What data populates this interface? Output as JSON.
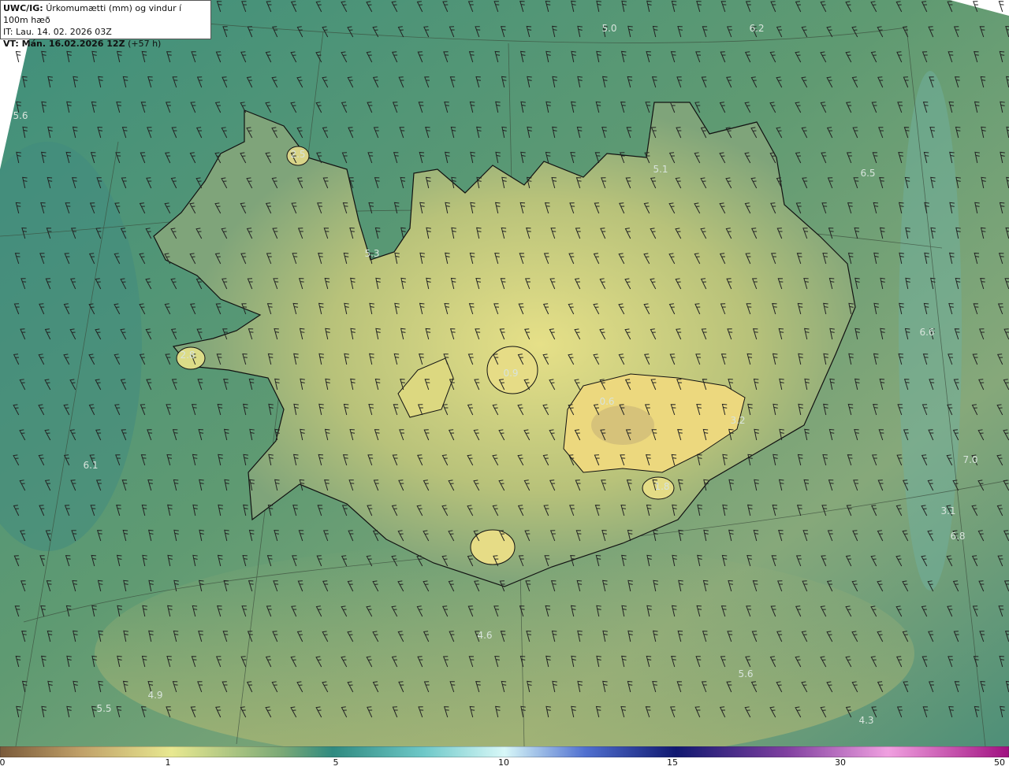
{
  "title": {
    "prefix": "UWC/IG:",
    "text": "Úrkomumætti (mm) og vindur í 100m hæð",
    "it": "IT: Lau. 14. 02. 2026 03Z",
    "vt_prefix": "VT: Mán. 16.02.2026 12Z",
    "vt_suffix": "(+57 h)"
  },
  "colorbar": {
    "ticks": [
      "0",
      "1",
      "5",
      "10",
      "15",
      "30",
      "50"
    ],
    "colors": [
      "#7a5a3a",
      "#c8a868",
      "#e8e890",
      "#4a8a70",
      "#3a9a98",
      "#b8f0f8",
      "#3050c0",
      "#102080",
      "#703090",
      "#e070c0",
      "#a01080"
    ]
  },
  "values": [
    {
      "label": "5.0"
    },
    {
      "label": "6.2"
    },
    {
      "label": "5.6"
    },
    {
      "label": "2.5"
    },
    {
      "label": "5.1"
    },
    {
      "label": "6.5"
    },
    {
      "label": "5.3"
    },
    {
      "label": "6.6"
    },
    {
      "label": "2.8"
    },
    {
      "label": "0.9"
    },
    {
      "label": "0.6"
    },
    {
      "label": "3.2"
    },
    {
      "label": "6.1"
    },
    {
      "label": "7.0"
    },
    {
      "label": "3.1"
    },
    {
      "label": "6.8"
    },
    {
      "label": "1.8"
    },
    {
      "label": "4.6"
    },
    {
      "label": "5.6"
    },
    {
      "label": "4.9"
    },
    {
      "label": "5.5"
    },
    {
      "label": "4.3"
    }
  ]
}
